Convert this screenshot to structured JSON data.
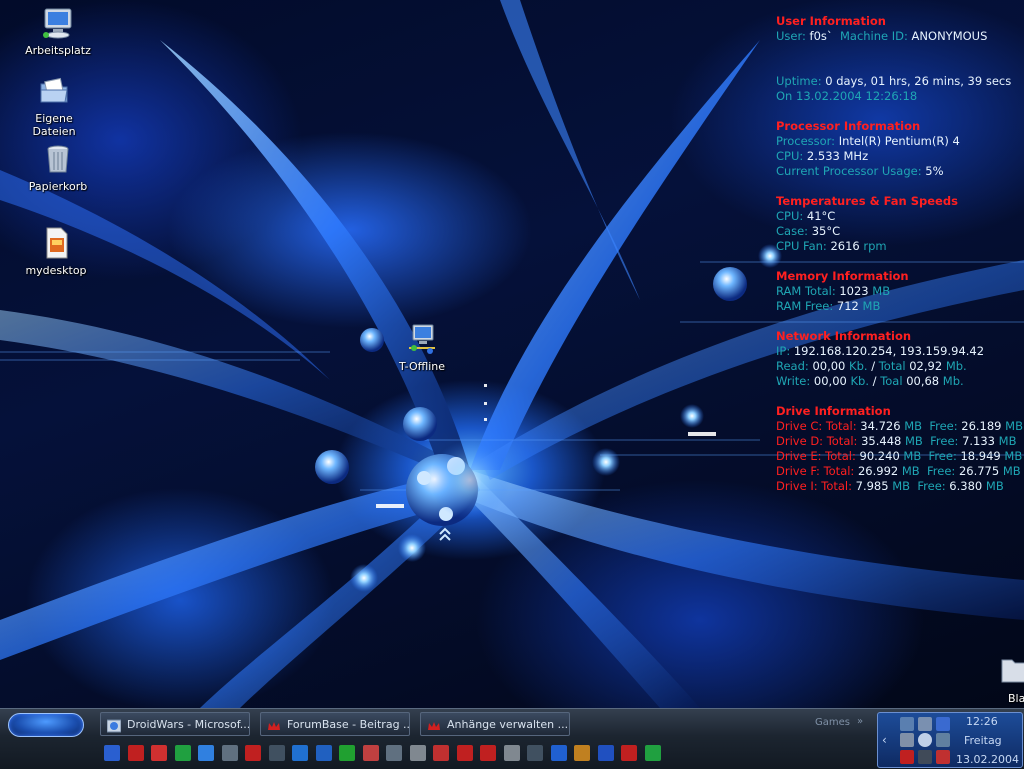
{
  "desktop": {
    "icons": [
      {
        "label": "Arbeitsplatz",
        "icon": "computer-icon"
      },
      {
        "label": "Eigene Dateien",
        "icon": "documents-folder-icon"
      },
      {
        "label": "Papierkorb",
        "icon": "recycle-bin-icon"
      },
      {
        "label": "mydesktop",
        "icon": "file-icon"
      },
      {
        "label": "T-Offline",
        "icon": "network-connection-icon"
      },
      {
        "label": "Bla",
        "icon": "folder-icon"
      }
    ]
  },
  "sysinfo": {
    "user": {
      "title": "User Information",
      "user_label": "User:",
      "user_value": "f0s`",
      "machine_label": "Machine ID:",
      "machine_value": "ANONYMOUS",
      "uptime_label": "Uptime:",
      "uptime_value": "0 days, 01 hrs, 26 mins, 39 secs",
      "on_label": "On",
      "on_value": "13.02.2004 12:26:18"
    },
    "processor": {
      "title": "Processor Information",
      "proc_label": "Processor:",
      "proc_value": "Intel(R) Pentium(R) 4",
      "cpu_label": "CPU:",
      "cpu_value": "2.533 MHz",
      "usage_label": "Current Processor Usage:",
      "usage_value": "5%"
    },
    "temps": {
      "title": "Temperatures & Fan Speeds",
      "cpu_label": "CPU:",
      "cpu_value": "41°C",
      "case_label": "Case:",
      "case_value": "35°C",
      "fan_label": "CPU Fan:",
      "fan_value": "2616",
      "fan_unit": "rpm"
    },
    "memory": {
      "title": "Memory Information",
      "total_label": "RAM Total:",
      "total_value": "1023",
      "total_unit": "MB",
      "free_label": "RAM Free:",
      "free_value": "712",
      "free_unit": "MB"
    },
    "network": {
      "title": "Network Information",
      "ip_label": "IP:",
      "ip_value": "192.168.120.254, 193.159.94.42",
      "read_label": "Read:",
      "read_value": "00,00",
      "read_unit": "Kb.",
      "read_sep": "/",
      "read_total_label": "Total",
      "read_total_value": "02,92",
      "read_total_unit": "Mb.",
      "write_label": "Write:",
      "write_value": "00,00",
      "write_unit": "Kb.",
      "write_sep": "/",
      "write_total_label": "Toal",
      "write_total_value": "00,68",
      "write_total_unit": "Mb."
    },
    "drives": {
      "title": "Drive Information",
      "total_label": "Total:",
      "free_label": "Free:",
      "unit": "MB",
      "rows": [
        {
          "name": "Drive C:",
          "total": "34.726",
          "free": "26.189"
        },
        {
          "name": "Drive D:",
          "total": "35.448",
          "free": "7.133"
        },
        {
          "name": "Drive E:",
          "total": "90.240",
          "free": "18.949"
        },
        {
          "name": "Drive F:",
          "total": "26.992",
          "free": "26.775"
        },
        {
          "name": "Drive I:",
          "total": "7.985",
          "free": "6.380"
        }
      ]
    }
  },
  "taskbar": {
    "buttons": [
      {
        "label": "DroidWars - Microsof...",
        "icon": "internet-explorer-icon"
      },
      {
        "label": "ForumBase - Beitrag ...",
        "icon": "crown-icon"
      },
      {
        "label": "Anhänge verwalten ...",
        "icon": "crown-icon"
      }
    ],
    "games_label": "Games",
    "games_arrow": "»",
    "tray": {
      "time": "12:26",
      "day": "Freitag",
      "date": "13.02.2004",
      "chevron": "‹"
    },
    "quicklaunch": [
      {
        "icon": "ie-icon",
        "color": "#2a5fd0"
      },
      {
        "icon": "acrobat-icon",
        "color": "#c02020"
      },
      {
        "icon": "pdf-tool-icon",
        "color": "#d03030"
      },
      {
        "icon": "green-circle-icon",
        "color": "#20a040"
      },
      {
        "icon": "globe-icon",
        "color": "#3080e0"
      },
      {
        "icon": "image-icon",
        "color": "#607080"
      },
      {
        "icon": "crown-icon",
        "color": "#c02020"
      },
      {
        "icon": "terminal-icon",
        "color": "#405060"
      },
      {
        "icon": "arrows-icon",
        "color": "#2070d0"
      },
      {
        "icon": "info-icon",
        "color": "#2060c0"
      },
      {
        "icon": "matrix-icon",
        "color": "#20a030"
      },
      {
        "icon": "book-icon",
        "color": "#c04040"
      },
      {
        "icon": "chip-icon",
        "color": "#607080"
      },
      {
        "icon": "gear-icon",
        "color": "#808890"
      },
      {
        "icon": "star-icon",
        "color": "#c03030"
      },
      {
        "icon": "tool-icon",
        "color": "#c02020"
      },
      {
        "icon": "game-icon",
        "color": "#c02020"
      },
      {
        "icon": "runner-icon",
        "color": "#808890"
      },
      {
        "icon": "pen-icon",
        "color": "#405060"
      },
      {
        "icon": "lightning-icon",
        "color": "#2060d0"
      },
      {
        "icon": "winamp-icon",
        "color": "#c08020"
      },
      {
        "icon": "word-icon",
        "color": "#2050c0"
      },
      {
        "icon": "red-app-icon",
        "color": "#c02020"
      },
      {
        "icon": "excel-icon",
        "color": "#20a040"
      }
    ]
  }
}
